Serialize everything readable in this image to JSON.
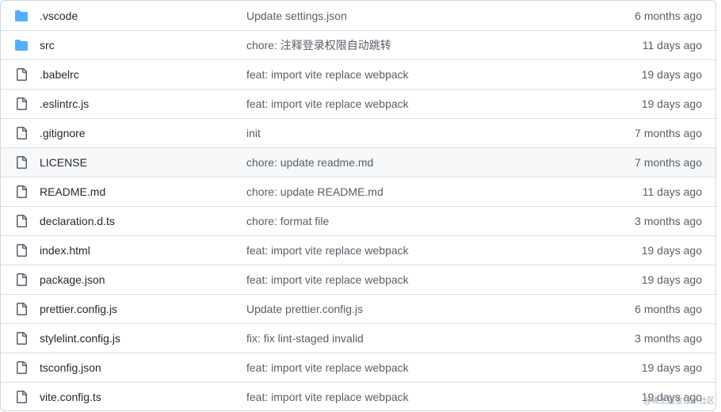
{
  "files": [
    {
      "name": ".vscode",
      "type": "folder",
      "message": "Update settings.json",
      "age": "6 months ago"
    },
    {
      "name": "src",
      "type": "folder",
      "message": "chore: 注释登录权限自动跳转",
      "age": "11 days ago"
    },
    {
      "name": ".babelrc",
      "type": "file",
      "message": "feat: import vite replace webpack",
      "age": "19 days ago"
    },
    {
      "name": ".eslintrc.js",
      "type": "file",
      "message": "feat: import vite replace webpack",
      "age": "19 days ago"
    },
    {
      "name": ".gitignore",
      "type": "file",
      "message": "init",
      "age": "7 months ago"
    },
    {
      "name": "LICENSE",
      "type": "file",
      "message": "chore: update readme.md",
      "age": "7 months ago",
      "highlighted": true
    },
    {
      "name": "README.md",
      "type": "file",
      "message": "chore: update README.md",
      "age": "11 days ago"
    },
    {
      "name": "declaration.d.ts",
      "type": "file",
      "message": "chore: format file",
      "age": "3 months ago"
    },
    {
      "name": "index.html",
      "type": "file",
      "message": "feat: import vite replace webpack",
      "age": "19 days ago"
    },
    {
      "name": "package.json",
      "type": "file",
      "message": "feat: import vite replace webpack",
      "age": "19 days ago"
    },
    {
      "name": "prettier.config.js",
      "type": "file",
      "message": "Update prettier.config.js",
      "age": "6 months ago"
    },
    {
      "name": "stylelint.config.js",
      "type": "file",
      "message": "fix: fix lint-staged invalid",
      "age": "3 months ago"
    },
    {
      "name": "tsconfig.json",
      "type": "file",
      "message": "feat: import vite replace webpack",
      "age": "19 days ago"
    },
    {
      "name": "vite.config.ts",
      "type": "file",
      "message": "feat: import vite replace webpack",
      "age": "19 days ago"
    }
  ],
  "icons": {
    "folder": "folder-icon",
    "file": "file-icon"
  },
  "colors": {
    "folder": "#54aeff",
    "file_outline": "#57606a",
    "highlight_row": "#f6f8fa",
    "border": "#d0d7de"
  },
  "watermark": "@稀土掘金技术社区"
}
